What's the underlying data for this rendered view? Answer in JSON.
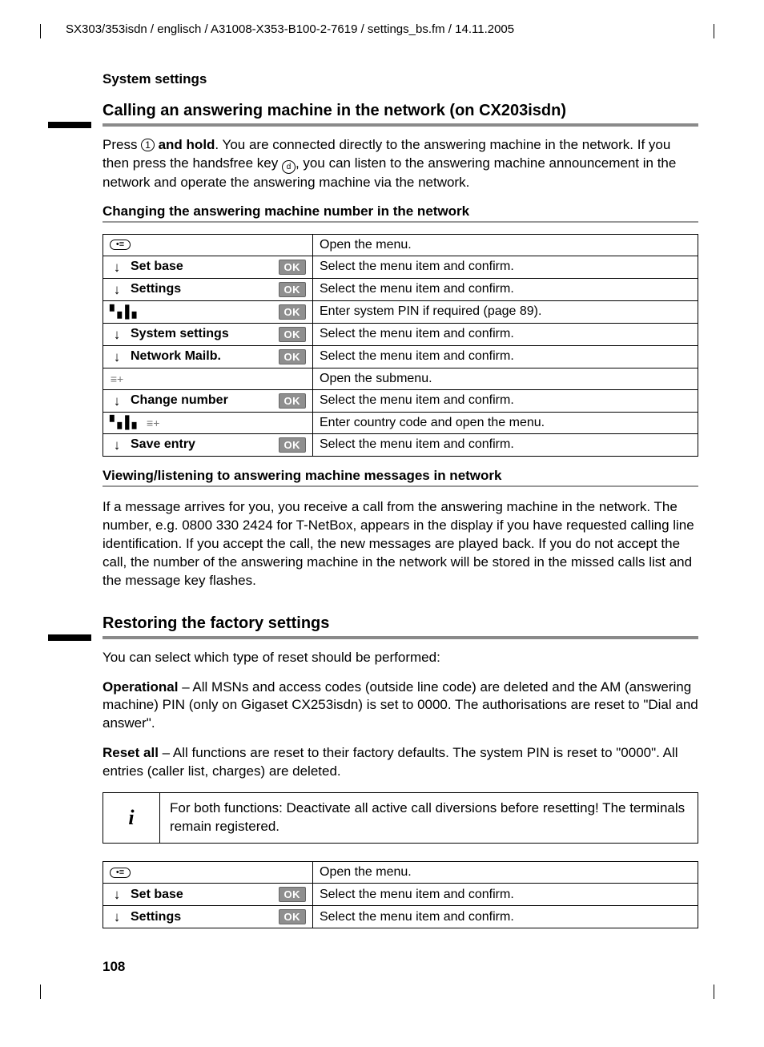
{
  "running_head": "SX303/353isdn / englisch / A31008-X353-B100-2-7619 / settings_bs.fm / 14.11.2005",
  "section_label": "System settings",
  "h2a": "Calling an answering machine in the network (on CX203isdn)",
  "para1_a": "Press ",
  "para1_key": "1",
  "para1_b": " and hold",
  "para1_c": ". You are connected directly to the answering machine in the network. If you then press the handsfree key ",
  "para1_round": "d",
  "para1_d": ", you can listen to the answering machine announcement in the network and operate the answering machine via the network.",
  "h3a": "Changing the answering machine number in the network",
  "table1": [
    {
      "icon": "menu",
      "label": "",
      "ok": false,
      "desc": "Open the menu."
    },
    {
      "icon": "down",
      "label": "Set base",
      "ok": true,
      "desc": "Select the menu item and confirm."
    },
    {
      "icon": "down",
      "label": "Settings",
      "ok": true,
      "desc": "Select the menu item and confirm."
    },
    {
      "icon": "keypad",
      "label": "",
      "ok": true,
      "desc": "Enter system PIN if required (page 89)."
    },
    {
      "icon": "down",
      "label": "System settings",
      "ok": true,
      "desc": "Select the menu item and confirm."
    },
    {
      "icon": "down",
      "label": "Network Mailb.",
      "ok": true,
      "desc": "Select the menu item and confirm."
    },
    {
      "icon": "submenu",
      "label": "",
      "ok": false,
      "desc": "Open the submenu."
    },
    {
      "icon": "down",
      "label": "Change number",
      "ok": true,
      "desc": "Select the menu item and confirm."
    },
    {
      "icon": "keypad-sub",
      "label": "",
      "ok": false,
      "desc": "Enter country code and open the menu."
    },
    {
      "icon": "down",
      "label": "Save entry",
      "ok": true,
      "desc": "Select the menu item and confirm."
    }
  ],
  "h3b": "Viewing/listening to answering machine messages in network",
  "para2": "If a message arrives for you, you receive a call from the answering machine in the network. The number, e.g. 0800 330 2424 for T-NetBox, appears in the display if you have requested calling line identification. If you accept the call, the new messages are played back. If you do not accept the call, the number of the answering machine in the network will be stored in the missed calls list and the message key flashes.",
  "h2b": "Restoring the factory settings",
  "para3": "You can select which type of reset should be performed:",
  "para4_b1": "Operational",
  "para4_t1": " – All MSNs and access codes (outside line code) are deleted and the AM (answering machine) PIN (only on Gigaset CX253isdn) is set to 0000. The authorisations are reset to \"Dial and answer\".",
  "para5_b1": "Reset all",
  "para5_t1": " – All functions are reset to their factory defaults. The system PIN is reset to \"0000\". All entries (caller list, charges) are deleted.",
  "info_text": "For both functions: Deactivate all active call diversions before resetting! The terminals remain registered.",
  "table2": [
    {
      "icon": "menu",
      "label": "",
      "ok": false,
      "desc": "Open the menu."
    },
    {
      "icon": "down",
      "label": "Set base",
      "ok": true,
      "desc": "Select the menu item and confirm."
    },
    {
      "icon": "down",
      "label": "Settings",
      "ok": true,
      "desc": "Select the menu item and confirm."
    }
  ],
  "page_number": "108",
  "ok_label": "OK"
}
